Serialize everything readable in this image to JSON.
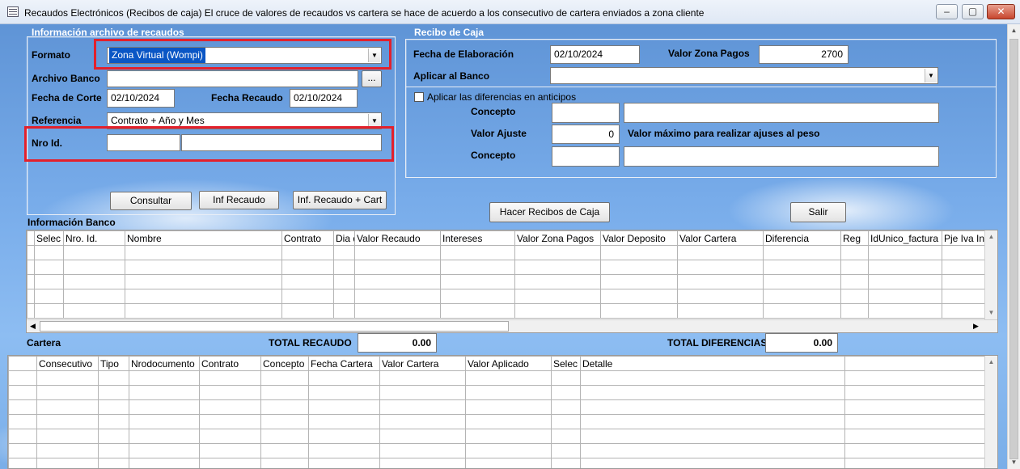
{
  "window": {
    "title": "Recaudos Electrónicos (Recibos de caja) El cruce de valores de recaudos vs cartera se hace de acuerdo a los consecutivo de cartera enviados a zona cliente",
    "minimize": "‒",
    "maximize": "▢",
    "close": "✕"
  },
  "info_archivo": {
    "group_title": "Información archivo de recaudos",
    "formato_label": "Formato",
    "formato_value": "Zona Virtual (Wompi)",
    "archivo_banco_label": "Archivo Banco",
    "archivo_banco_value": "",
    "browse_label": "...",
    "fecha_corte_label": "Fecha de Corte",
    "fecha_corte_value": "02/10/2024",
    "fecha_recaudo_label": "Fecha Recaudo",
    "fecha_recaudo_value": "02/10/2024",
    "referencia_label": "Referencia",
    "referencia_value": "Contrato + Año y Mes",
    "nro_id_label": "Nro Id.",
    "nro_id_value": "",
    "nro_id_name_value": "",
    "consultar_label": "Consultar",
    "inf_recaudo_label": "Inf Recaudo",
    "inf_recaudo_cart_label": "Inf. Recaudo + Cart"
  },
  "recibo_caja": {
    "group_title": "Recibo de Caja",
    "fecha_elaboracion_label": "Fecha de Elaboración",
    "fecha_elaboracion_value": "02/10/2024",
    "valor_zona_pagos_label": "Valor Zona Pagos",
    "valor_zona_pagos_value": "2700",
    "aplicar_banco_label": "Aplicar al Banco",
    "aplicar_banco_value": "",
    "aplicar_diferencias_label": "Aplicar las diferencias en anticipos",
    "aplicar_diferencias_checked": false,
    "concepto1_label": "Concepto",
    "concepto1_code": "",
    "concepto1_desc": "",
    "valor_ajuste_label": "Valor Ajuste",
    "valor_ajuste_value": "0",
    "valor_maximo_text": "Valor máximo para realizar ajuses al peso",
    "concepto2_label": "Concepto",
    "concepto2_code": "",
    "concepto2_desc": ""
  },
  "actions": {
    "hacer_recibos_label": "Hacer Recibos de Caja",
    "salir_label": "Salir"
  },
  "informacion_banco": {
    "title": "Información Banco",
    "columns": [
      "",
      "Selec",
      "Nro. Id.",
      "Nombre",
      "Contrato",
      "Dia de",
      "Valor Recaudo",
      "Intereses",
      "Valor Zona Pagos",
      "Valor Deposito",
      "Valor Cartera",
      "Diferencia",
      "Reg",
      "IdUnico_factura",
      "Pje Iva Int"
    ],
    "row_count": 5
  },
  "totals": {
    "cartera_title": "Cartera",
    "total_recaudo_label": "TOTAL RECAUDO",
    "total_recaudo_value": "0.00",
    "total_diferencias_label": "TOTAL DIFERENCIAS",
    "total_diferencias_value": "0.00"
  },
  "cartera": {
    "columns": [
      "",
      "Consecutivo",
      "Tipo",
      "Nrodocumento",
      "Contrato",
      "Concepto",
      "Fecha Cartera",
      "Valor Cartera",
      "Valor Aplicado",
      "Selec",
      "Detalle",
      ""
    ],
    "row_count": 7
  },
  "icons": {
    "dropdown": "▼",
    "scroll_up": "▲",
    "scroll_down": "▼",
    "scroll_left": "◀",
    "scroll_right": "▶"
  }
}
